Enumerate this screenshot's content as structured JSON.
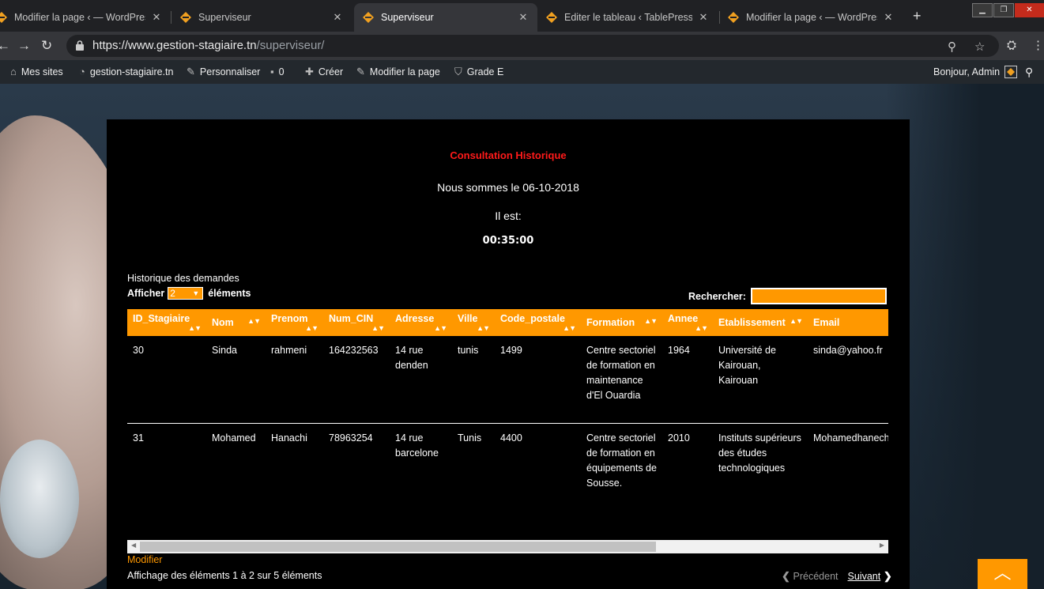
{
  "browser": {
    "tabs": [
      {
        "title": "Modifier la page ‹ — WordPress",
        "active": false
      },
      {
        "title": "Superviseur",
        "active": false
      },
      {
        "title": "Superviseur",
        "active": true
      },
      {
        "title": "Editer le tableau ‹ TablePress ‹ —",
        "active": false
      },
      {
        "title": "Modifier la page ‹ — WordPress",
        "active": false
      }
    ],
    "close_glyph": "✕",
    "new_tab_glyph": "+",
    "url_host": "https://www.gestion-stagiaire.tn",
    "url_path": "/superviseur/"
  },
  "adminbar": {
    "items": [
      {
        "label": "Mes sites",
        "icon": "sites-icon"
      },
      {
        "label": "gestion-stagiaire.tn",
        "icon": "dashboard-icon"
      },
      {
        "label": "Personnaliser",
        "icon": "brush-icon"
      },
      {
        "label": "0",
        "icon": "comment-icon"
      },
      {
        "label": "Créer",
        "icon": "plus-icon"
      },
      {
        "label": "Modifier la page",
        "icon": "pencil-icon"
      },
      {
        "label": "Grade E",
        "icon": "shield-icon"
      }
    ],
    "greeting": "Bonjour, Admin"
  },
  "page": {
    "title": "Consultation Historique",
    "date_line": "Nous sommes le 06-10-2018",
    "time_label": "Il est:",
    "time_value": "00:35:00",
    "caption": "Historique des demandes",
    "length_prefix": "Afficher",
    "length_value": "2",
    "length_suffix": "éléments",
    "search_label": "Rechercher:",
    "search_value": "",
    "columns": [
      "ID_Stagiaire",
      "Nom",
      "Prenom",
      "Num_CIN",
      "Adresse",
      "Ville",
      "Code_postale",
      "Formation",
      "Annee",
      "Etablissement",
      "Email"
    ],
    "rows": [
      [
        "30",
        "Sinda",
        "rahmeni",
        "164232563",
        "14 rue denden",
        "tunis",
        "1499",
        "Centre sectoriel de formation en maintenance d'El Ouardia",
        "1964",
        "Université de Kairouan, Kairouan",
        "sinda@yahoo.fr"
      ],
      [
        "31",
        "Mohamed",
        "Hanachi",
        "78963254",
        "14 rue barcelone",
        "Tunis",
        "4400",
        "Centre sectoriel de formation en équipements de Sousse.",
        "2010",
        "Instituts supérieurs des études technologiques",
        "Mohamedhanechi"
      ]
    ],
    "modifier_link": "Modifier",
    "info": "Affichage des éléments 1 à 2 sur 5 éléments",
    "prev_label": "Précédent",
    "next_label": "Suivant"
  },
  "colors": {
    "accent": "#ff9800",
    "title_red": "#ff1a1a",
    "panel_bg": "#000000"
  }
}
